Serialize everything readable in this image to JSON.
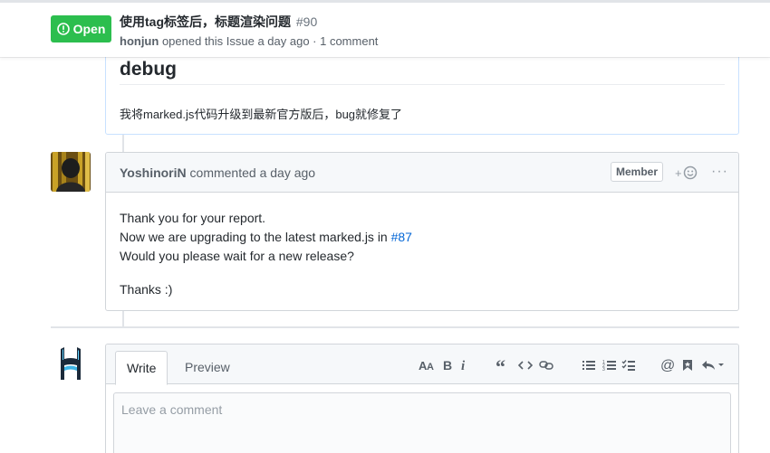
{
  "header": {
    "state_label": "Open",
    "title": "使用tag标签后，标题渲染问题",
    "number": "#90",
    "author": "honjun",
    "meta_text": " opened this Issue a day ago · 1 comment"
  },
  "first_comment": {
    "heading": "debug",
    "paragraph": "我将marked.js代码升级到最新官方版后，bug就修复了"
  },
  "second_comment": {
    "author": "YoshinoriN",
    "action": " commented a day ago",
    "badge": "Member",
    "reaction": "+",
    "more": "···",
    "lines": {
      "line1": "Thank you for your report.",
      "line2_prefix": "Now we are upgrading to the latest marked.js in ",
      "line2_link": "#87",
      "line3": "Would you please wait for a new release?",
      "line4": "Thanks :)"
    }
  },
  "new_comment": {
    "tab_write": "Write",
    "tab_preview": "Preview",
    "placeholder": "Leave a comment",
    "toolbar": [
      "header-icon",
      "bold-icon",
      "italic-icon",
      "quote-icon",
      "code-icon",
      "link-icon",
      "unordered-list-icon",
      "ordered-list-icon",
      "task-list-icon",
      "mention-icon",
      "saved-reply-icon",
      "reply-icon"
    ]
  },
  "colors": {
    "open_green": "#2cbe4e",
    "link_blue": "#0366d6",
    "muted": "#586069",
    "author_border": "#c8e1ff"
  }
}
